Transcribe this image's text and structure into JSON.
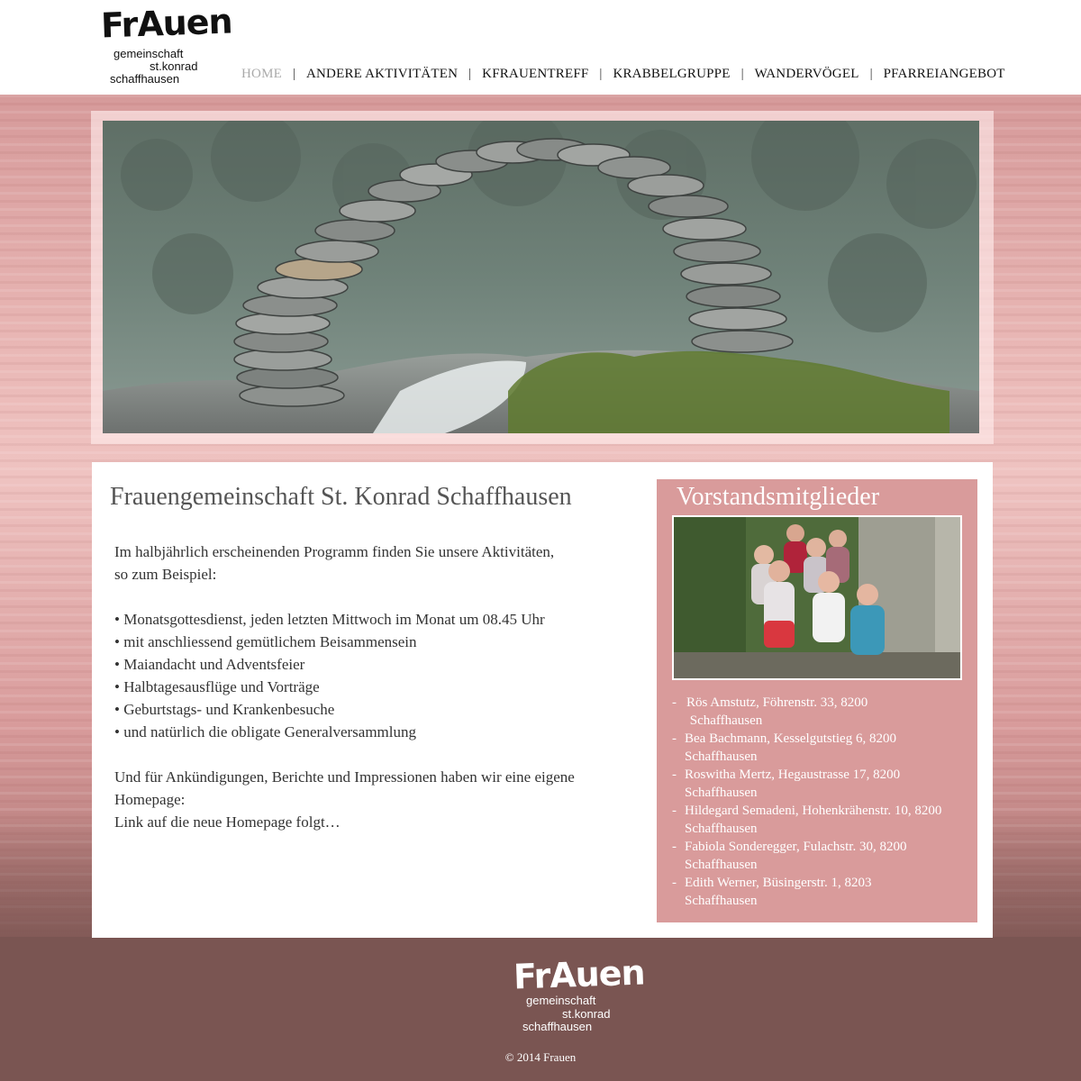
{
  "logo": {
    "word": "FrAuen",
    "line1": "gemeinschaft",
    "line2": "st.konrad",
    "line3": "schaffhausen"
  },
  "nav": {
    "items": [
      {
        "label": "HOME",
        "active": true
      },
      {
        "label": "ANDERE AKTIVITÄTEN"
      },
      {
        "label": "KFRAUENTREFF"
      },
      {
        "label": "KRABBELGRUPPE"
      },
      {
        "label": "WANDERVÖGEL"
      },
      {
        "label": "PFARREIANGEBOT"
      }
    ],
    "separator": "|"
  },
  "main": {
    "title": "Frauengemeinschaft St. Konrad Schaffhausen",
    "intro1": "Im halbjährlich erscheinenden Programm  finden Sie unsere Aktivitäten,",
    "intro2": "so zum Beispiel:",
    "bullets": [
      "• Monatsgottesdienst, jeden letzten Mittwoch im Monat um 08.45 Uhr",
      "• mit anschliessend gemütlichem Beisammensein",
      "• Maiandacht und Adventsfeier",
      "• Halbtagesausflüge und Vorträge",
      "• Geburtstags- und Krankenbesuche",
      "• und natürlich die obligate Generalversammlung"
    ],
    "outro1": "Und für Ankündigungen, Berichte und Impressionen haben wir eine eigene",
    "outro2": "Homepage:",
    "outro3": "Link auf die neue Homepage folgt…"
  },
  "sidebar": {
    "title": "Vorstandsmitglieder",
    "dash": "-",
    "members": [
      {
        "line1": "Rös Amstutz, Föhrenstr. 33,  8200",
        "line2": " Schaffhausen"
      },
      {
        "line1": "Bea Bachmann, Kesselgutstieg 6, 8200",
        "line2": "Schaffhausen"
      },
      {
        "line1": "Roswitha Mertz, Hegaustrasse 17, 8200",
        "line2": "Schaffhausen"
      },
      {
        "line1": "Hildegard Semadeni, Hohenkrähenstr. 10, 8200",
        "line2": "Schaffhausen"
      },
      {
        "line1": "Fabiola Sonderegger, Fulachstr. 30, 8200",
        "line2": "Schaffhausen"
      },
      {
        "line1": "Edith Werner, Büsingerstr. 1, 8203",
        "line2": "Schaffhausen"
      }
    ]
  },
  "footer": {
    "copyright": "© 2014 Frauen"
  },
  "colors": {
    "accent": "#d99b9b",
    "footer": "#7a5552",
    "nav_active": "#aaaaaa"
  }
}
